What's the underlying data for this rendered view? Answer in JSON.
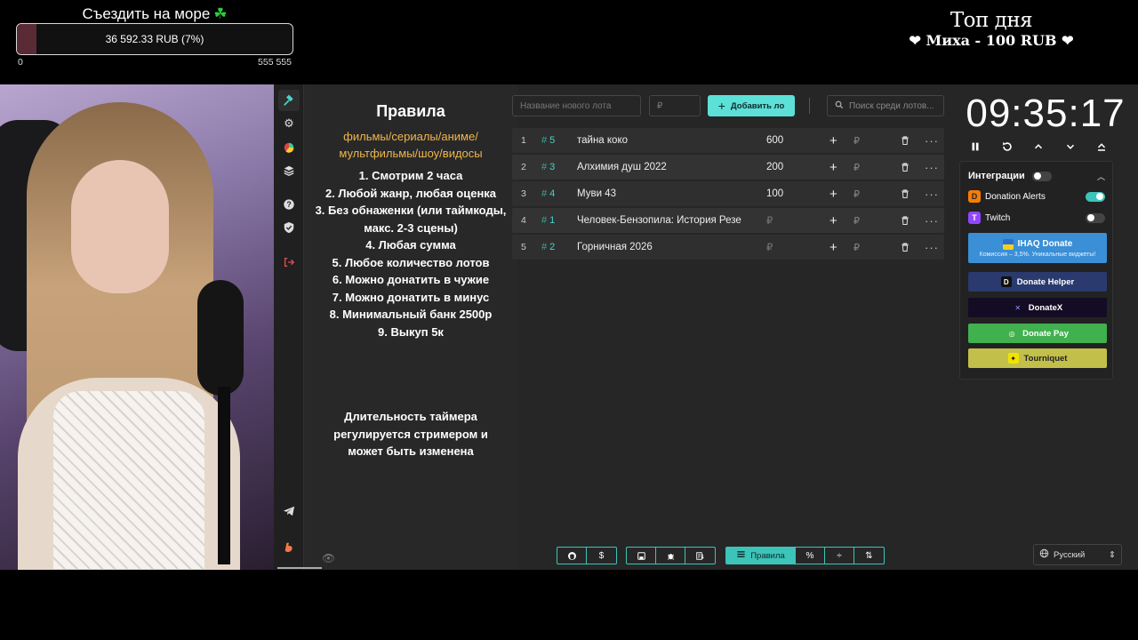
{
  "overlay": {
    "goal_title": "Съездить на море",
    "goal_amount": "36 592.33 RUB (7%)",
    "goal_progress_fraction": 0.07,
    "goal_min": "0",
    "goal_max": "555 555",
    "top_day_title": "Топ дня",
    "top_day_entry": "Миха - 100 RUB"
  },
  "rules": {
    "title": "Правила",
    "categories": "фильмы/сериалы/аниме/ мультфильмы/шоу/видосы",
    "items": [
      "1. Смотрим 2 часа",
      "2. Любой жанр, любая оценка",
      "3. Без обнаженки (или таймкоды, макс. 2-3 сцены)",
      "4. Любая сумма",
      "5. Любое количество лотов",
      "6. Можно донатить в чужие",
      "7. Можно донатить в минус",
      "8. Минимальный банк 2500р",
      "9. Выкуп 5к"
    ],
    "timer_note": "Длительность таймера регулируется стримером и может быть изменена"
  },
  "lot_bar": {
    "name_placeholder": "Название нового лота",
    "amount_placeholder": "₽",
    "add_label": "Добавить ло",
    "search_placeholder": "Поиск среди лотов..."
  },
  "lots": [
    {
      "idx": "1",
      "fast": "5",
      "name": "тайна коко",
      "amount": "600",
      "cur": "₽"
    },
    {
      "idx": "2",
      "fast": "3",
      "name": "Алхимия душ 2022",
      "amount": "200",
      "cur": "₽"
    },
    {
      "idx": "3",
      "fast": "4",
      "name": "Муви 43",
      "amount": "100",
      "cur": "₽"
    },
    {
      "idx": "4",
      "fast": "1",
      "name": "Человек-Бензопила: История Резе",
      "amount": "₽",
      "cur": "₽"
    },
    {
      "idx": "5",
      "fast": "2",
      "name": "Горничная 2026",
      "amount": "₽",
      "cur": "₽"
    }
  ],
  "timer": {
    "value": "09:35:17"
  },
  "integrations": {
    "title": "Интеграции",
    "donation_alerts": "Donation Alerts",
    "twitch": "Twitch",
    "ihaq_title": "IHAQ Donate",
    "ihaq_sub": "Комиссия – 3,5%. Уникальные виджеты!",
    "donate_helper": "Donate Helper",
    "donatex": "DonateX",
    "donate_pay": "Donate Pay",
    "tourniquet": "Tourniquet"
  },
  "toolbar": {
    "rules_label": "Правила"
  },
  "language": {
    "value": "Русский"
  },
  "colors": {
    "accent": "#3cc4b8",
    "rules_categories": "#f0b64a"
  }
}
